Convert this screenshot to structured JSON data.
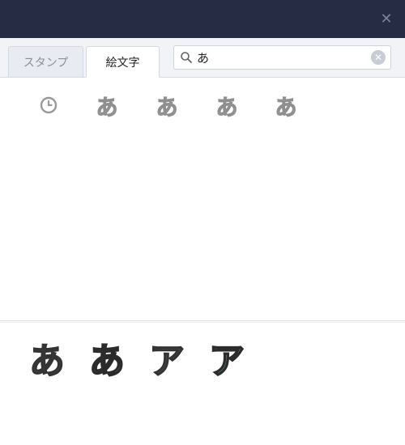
{
  "titlebar": {
    "bg_color": "#262c44",
    "close_icon": "close-icon"
  },
  "tabs": [
    {
      "label": "スタンプ",
      "active": false
    },
    {
      "label": "絵文字",
      "active": true
    }
  ],
  "search": {
    "value": "あ",
    "icon": "search-icon",
    "clear_icon": "clear-icon"
  },
  "emoji_grid": {
    "recent_icon": "clock-icon",
    "items": [
      "あ",
      "あ",
      "あ",
      "あ"
    ]
  },
  "preview": {
    "items": [
      {
        "char": "あ",
        "style": "dark"
      },
      {
        "char": "あ",
        "style": "cyan"
      },
      {
        "char": "ア",
        "style": "dark"
      },
      {
        "char": "ア",
        "style": "cyan"
      }
    ]
  }
}
